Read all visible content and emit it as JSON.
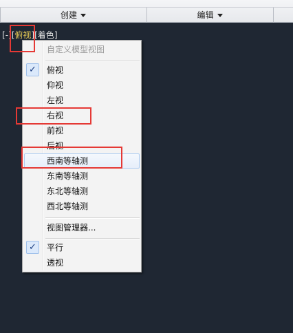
{
  "ribbon": {
    "groups": [
      {
        "label": "创建"
      },
      {
        "label": "编辑"
      }
    ]
  },
  "viewport_label": {
    "open": "[",
    "minus": "-",
    "mid": "][",
    "view": "俯视",
    "close_open": "][",
    "style": "着色",
    "end": "]"
  },
  "menu": {
    "header": "自定义模型视图",
    "views": [
      {
        "label": "俯视",
        "checked": true
      },
      {
        "label": "仰视",
        "checked": false
      },
      {
        "label": "左视",
        "checked": false
      },
      {
        "label": "右视",
        "checked": false
      },
      {
        "label": "前视",
        "checked": false
      },
      {
        "label": "后视",
        "checked": false
      },
      {
        "label": "西南等轴测",
        "checked": false,
        "hovered": true
      },
      {
        "label": "东南等轴测",
        "checked": false
      },
      {
        "label": "东北等轴测",
        "checked": false
      },
      {
        "label": "西北等轴测",
        "checked": false
      }
    ],
    "manager": "视图管理器...",
    "projection": [
      {
        "label": "平行",
        "checked": true
      },
      {
        "label": "透视",
        "checked": false
      }
    ],
    "check_glyph": "✓"
  },
  "colors": {
    "canvas_bg": "#1f2733",
    "annotation": "#e53935",
    "highlight_text": "#e9cd56"
  }
}
